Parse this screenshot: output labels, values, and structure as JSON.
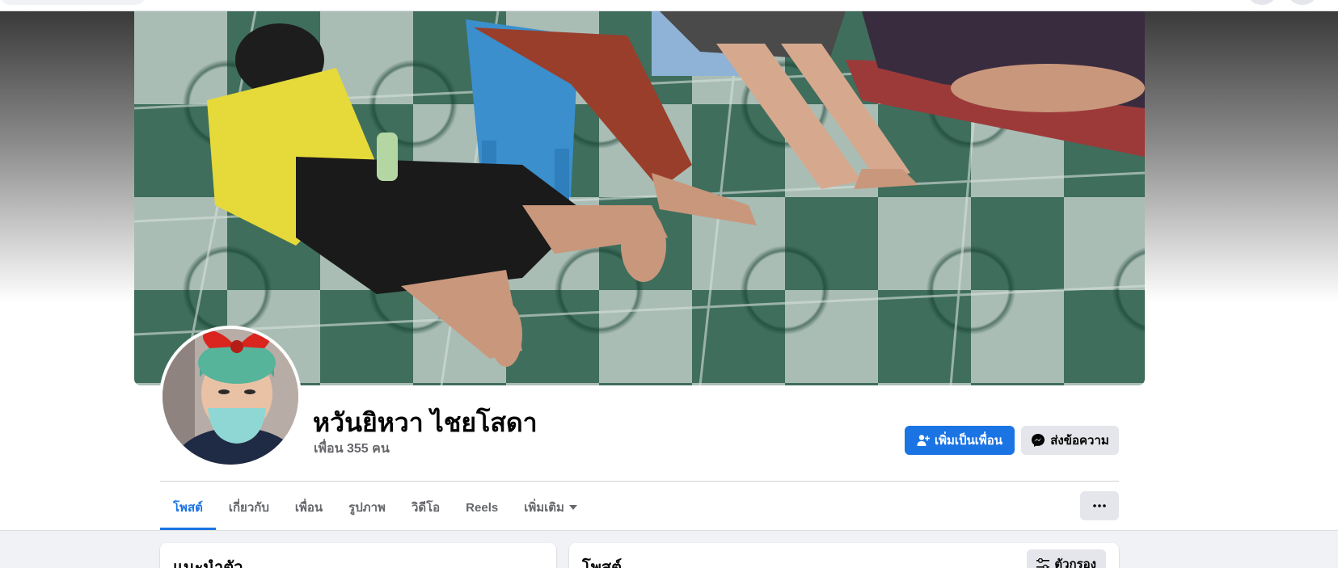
{
  "profile": {
    "name": "หวันยิหวา ไชยโสดา",
    "friends": "เพื่อน 355 คน"
  },
  "actions": {
    "add_friend": "เพิ่มเป็นเพื่อน",
    "message": "ส่งข้อความ"
  },
  "tabs": [
    {
      "label": "โพสต์",
      "active": true
    },
    {
      "label": "เกี่ยวกับ",
      "active": false
    },
    {
      "label": "เพื่อน",
      "active": false
    },
    {
      "label": "รูปภาพ",
      "active": false
    },
    {
      "label": "วิดีโอ",
      "active": false
    },
    {
      "label": "Reels",
      "active": false
    },
    {
      "label": "เพิ่มเติม",
      "active": false
    }
  ],
  "intro_card": {
    "title": "แนะนำตัว"
  },
  "posts_card": {
    "title": "โพสต์",
    "filter_label": "ตัวกรอง"
  },
  "colors": {
    "accent": "#1b74e4",
    "secondary_button": "#e4e6eb",
    "feed_background": "#f0f2f5",
    "muted_text": "#65676b"
  },
  "icons": {
    "add_friend": "person-plus-icon",
    "message": "messenger-icon",
    "more": "ellipsis-icon",
    "dropdown": "caret-down-icon",
    "filter": "sliders-icon"
  }
}
